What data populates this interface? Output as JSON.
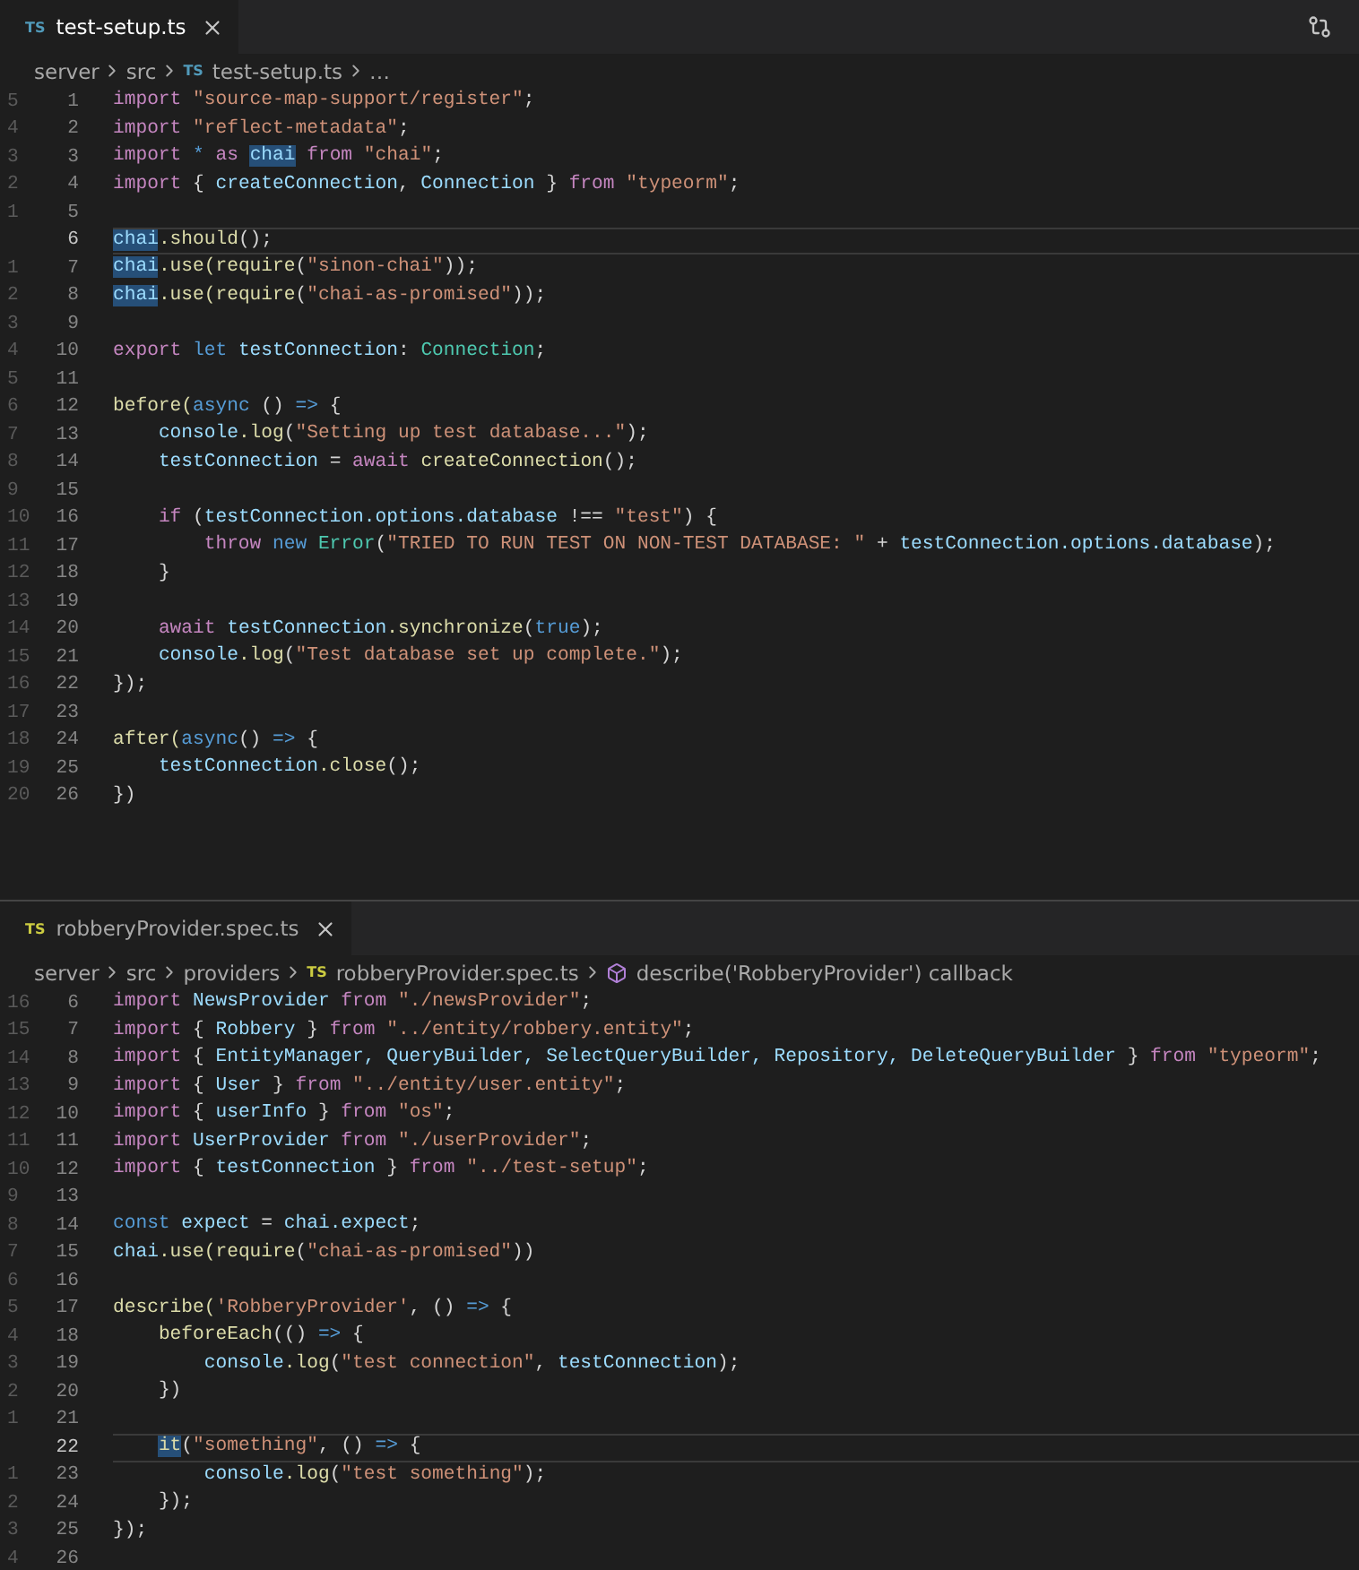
{
  "panes": [
    {
      "tab": {
        "badge": "TS",
        "color": "#519aba",
        "label": "test-setup.ts",
        "focused": true
      },
      "breadcrumb": [
        {
          "kind": "segment",
          "text": "server"
        },
        {
          "kind": "segment",
          "text": "src"
        },
        {
          "kind": "file",
          "badge": "TS",
          "color": "#519aba",
          "text": "test-setup.ts"
        },
        {
          "kind": "segment",
          "text": "…"
        }
      ],
      "lines": [
        {
          "rel": "5",
          "num": "1",
          "current": false,
          "tokens": [
            {
              "text": "import ",
              "kind": "keyword"
            },
            {
              "text": "\"source-map-support/register\"",
              "kind": "string"
            },
            {
              "text": ";",
              "kind": "plain"
            }
          ]
        },
        {
          "rel": "4",
          "num": "2",
          "current": false,
          "tokens": [
            {
              "text": "import ",
              "kind": "keyword"
            },
            {
              "text": "\"reflect-metadata\"",
              "kind": "string"
            },
            {
              "text": ";",
              "kind": "plain"
            }
          ]
        },
        {
          "rel": "3",
          "num": "3",
          "current": false,
          "tokens": [
            {
              "text": "import ",
              "kind": "keyword"
            },
            {
              "text": "* ",
              "kind": "storage"
            },
            {
              "text": "as ",
              "kind": "keyword"
            },
            {
              "text": "chai",
              "kind": "variable",
              "highlighted": true
            },
            {
              "text": " from ",
              "kind": "keyword"
            },
            {
              "text": "\"chai\"",
              "kind": "string"
            },
            {
              "text": ";",
              "kind": "plain"
            }
          ]
        },
        {
          "rel": "2",
          "num": "4",
          "current": false,
          "tokens": [
            {
              "text": "import ",
              "kind": "keyword"
            },
            {
              "text": "{ ",
              "kind": "plain"
            },
            {
              "text": "createConnection",
              "kind": "variable"
            },
            {
              "text": ", ",
              "kind": "plain"
            },
            {
              "text": "Connection",
              "kind": "variable"
            },
            {
              "text": " } ",
              "kind": "plain"
            },
            {
              "text": "from ",
              "kind": "keyword"
            },
            {
              "text": "\"typeorm\"",
              "kind": "string"
            },
            {
              "text": ";",
              "kind": "plain"
            }
          ]
        },
        {
          "rel": "1",
          "num": "5",
          "current": false
        },
        {
          "num": "6",
          "current": true,
          "tokens": [
            {
              "text": "chai",
              "kind": "variable",
              "highlighted": true
            },
            {
              "text": ".should",
              "kind": "function"
            },
            {
              "text": "();",
              "kind": "plain"
            }
          ]
        },
        {
          "rel": "1",
          "num": "7",
          "current": false,
          "tokens": [
            {
              "text": "chai",
              "kind": "variable",
              "highlighted": true
            },
            {
              "text": ".use(require",
              "kind": "function"
            },
            {
              "text": "(",
              "kind": "plain"
            },
            {
              "text": "\"sinon-chai\"",
              "kind": "string"
            },
            {
              "text": "));",
              "kind": "plain"
            }
          ]
        },
        {
          "rel": "2",
          "num": "8",
          "current": false,
          "tokens": [
            {
              "text": "chai",
              "kind": "variable",
              "highlighted": true
            },
            {
              "text": ".use(require",
              "kind": "function"
            },
            {
              "text": "(",
              "kind": "plain"
            },
            {
              "text": "\"chai-as-promised\"",
              "kind": "string"
            },
            {
              "text": "));",
              "kind": "plain"
            }
          ]
        },
        {
          "rel": "3",
          "num": "9",
          "current": false
        },
        {
          "rel": "4",
          "num": "10",
          "current": false,
          "tokens": [
            {
              "text": "export ",
              "kind": "keyword"
            },
            {
              "text": "let ",
              "kind": "storage"
            },
            {
              "text": "testConnection",
              "kind": "variable"
            },
            {
              "text": ": ",
              "kind": "plain"
            },
            {
              "text": "Connection",
              "kind": "type"
            },
            {
              "text": ";",
              "kind": "plain"
            }
          ]
        },
        {
          "rel": "5",
          "num": "11",
          "current": false
        },
        {
          "rel": "6",
          "num": "12",
          "current": false,
          "tokens": [
            {
              "text": "before(",
              "kind": "function"
            },
            {
              "text": "async ",
              "kind": "storage"
            },
            {
              "text": "() ",
              "kind": "plain"
            },
            {
              "text": "=>",
              "kind": "storage"
            },
            {
              "text": " {",
              "kind": "plain"
            }
          ]
        },
        {
          "rel": "7",
          "num": "13",
          "current": false,
          "tokens": [
            {
              "text": "    console",
              "kind": "variable"
            },
            {
              "text": ".log",
              "kind": "function"
            },
            {
              "text": "(",
              "kind": "plain"
            },
            {
              "text": "\"Setting up test database...\"",
              "kind": "string"
            },
            {
              "text": ");",
              "kind": "plain"
            }
          ]
        },
        {
          "rel": "8",
          "num": "14",
          "current": false,
          "tokens": [
            {
              "text": "    testConnection",
              "kind": "variable"
            },
            {
              "text": " = ",
              "kind": "plain"
            },
            {
              "text": "await ",
              "kind": "keyword"
            },
            {
              "text": "createConnection",
              "kind": "function"
            },
            {
              "text": "();",
              "kind": "plain"
            }
          ]
        },
        {
          "rel": "9",
          "num": "15",
          "current": false
        },
        {
          "rel": "10",
          "num": "16",
          "current": false,
          "tokens": [
            {
              "text": "    if ",
              "kind": "keyword"
            },
            {
              "text": "(",
              "kind": "plain"
            },
            {
              "text": "testConnection.options.database",
              "kind": "variable"
            },
            {
              "text": " !== ",
              "kind": "plain"
            },
            {
              "text": "\"test\"",
              "kind": "string"
            },
            {
              "text": ") {",
              "kind": "plain"
            }
          ]
        },
        {
          "rel": "11",
          "num": "17",
          "current": false,
          "tokens": [
            {
              "text": "        throw ",
              "kind": "keyword"
            },
            {
              "text": "new ",
              "kind": "storage"
            },
            {
              "text": "Error",
              "kind": "type"
            },
            {
              "text": "(",
              "kind": "plain"
            },
            {
              "text": "\"TRIED TO RUN TEST ON NON-TEST DATABASE: \"",
              "kind": "string"
            },
            {
              "text": " + ",
              "kind": "plain"
            },
            {
              "text": "testConnection.options.database",
              "kind": "variable"
            },
            {
              "text": ");",
              "kind": "plain"
            }
          ]
        },
        {
          "rel": "12",
          "num": "18",
          "current": false,
          "tokens": [
            {
              "text": "    }",
              "kind": "plain"
            }
          ]
        },
        {
          "rel": "13",
          "num": "19",
          "current": false
        },
        {
          "rel": "14",
          "num": "20",
          "current": false,
          "tokens": [
            {
              "text": "    await ",
              "kind": "keyword"
            },
            {
              "text": "testConnection",
              "kind": "variable"
            },
            {
              "text": ".synchronize",
              "kind": "function"
            },
            {
              "text": "(",
              "kind": "plain"
            },
            {
              "text": "true",
              "kind": "storage"
            },
            {
              "text": ");",
              "kind": "plain"
            }
          ]
        },
        {
          "rel": "15",
          "num": "21",
          "current": false,
          "tokens": [
            {
              "text": "    console",
              "kind": "variable"
            },
            {
              "text": ".log",
              "kind": "function"
            },
            {
              "text": "(",
              "kind": "plain"
            },
            {
              "text": "\"Test database set up complete.\"",
              "kind": "string"
            },
            {
              "text": ");",
              "kind": "plain"
            }
          ]
        },
        {
          "rel": "16",
          "num": "22",
          "current": false,
          "tokens": [
            {
              "text": "});",
              "kind": "plain"
            }
          ]
        },
        {
          "rel": "17",
          "num": "23",
          "current": false
        },
        {
          "rel": "18",
          "num": "24",
          "current": false,
          "tokens": [
            {
              "text": "after(",
              "kind": "function"
            },
            {
              "text": "async",
              "kind": "storage"
            },
            {
              "text": "() ",
              "kind": "plain"
            },
            {
              "text": "=>",
              "kind": "storage"
            },
            {
              "text": " {",
              "kind": "plain"
            }
          ]
        },
        {
          "rel": "19",
          "num": "25",
          "current": false,
          "tokens": [
            {
              "text": "    testConnection",
              "kind": "variable"
            },
            {
              "text": ".close",
              "kind": "function"
            },
            {
              "text": "();",
              "kind": "plain"
            }
          ]
        },
        {
          "rel": "20",
          "num": "26",
          "current": false,
          "tokens": [
            {
              "text": "})",
              "kind": "plain"
            }
          ]
        }
      ]
    },
    {
      "tab": {
        "badge": "TS",
        "color": "#cbcb41",
        "label": "robberyProvider.spec.ts",
        "focused": false
      },
      "breadcrumb": [
        {
          "kind": "segment",
          "text": "server"
        },
        {
          "kind": "segment",
          "text": "src"
        },
        {
          "kind": "segment",
          "text": "providers"
        },
        {
          "kind": "file",
          "badge": "TS",
          "color": "#cbcb41",
          "text": "robberyProvider.spec.ts"
        },
        {
          "kind": "symbol",
          "text": "describe('RobberyProvider') callback"
        }
      ],
      "lines": [
        {
          "rel": "16",
          "num": "6",
          "current": false,
          "tokens": [
            {
              "text": "import ",
              "kind": "keyword"
            },
            {
              "text": "NewsProvider",
              "kind": "variable"
            },
            {
              "text": " from ",
              "kind": "keyword"
            },
            {
              "text": "\"./newsProvider\"",
              "kind": "string"
            },
            {
              "text": ";",
              "kind": "plain"
            }
          ]
        },
        {
          "rel": "15",
          "num": "7",
          "current": false,
          "tokens": [
            {
              "text": "import ",
              "kind": "keyword"
            },
            {
              "text": "{ ",
              "kind": "plain"
            },
            {
              "text": "Robbery",
              "kind": "variable"
            },
            {
              "text": " } ",
              "kind": "plain"
            },
            {
              "text": "from ",
              "kind": "keyword"
            },
            {
              "text": "\"../entity/robbery.entity\"",
              "kind": "string"
            },
            {
              "text": ";",
              "kind": "plain"
            }
          ]
        },
        {
          "rel": "14",
          "num": "8",
          "current": false,
          "tokens": [
            {
              "text": "import ",
              "kind": "keyword"
            },
            {
              "text": "{ ",
              "kind": "plain"
            },
            {
              "text": "EntityManager, QueryBuilder, SelectQueryBuilder, Repository, DeleteQueryBuilder",
              "kind": "variable"
            },
            {
              "text": " } ",
              "kind": "plain"
            },
            {
              "text": "from ",
              "kind": "keyword"
            },
            {
              "text": "\"typeorm\"",
              "kind": "string"
            },
            {
              "text": ";",
              "kind": "plain"
            }
          ]
        },
        {
          "rel": "13",
          "num": "9",
          "current": false,
          "tokens": [
            {
              "text": "import ",
              "kind": "keyword"
            },
            {
              "text": "{ ",
              "kind": "plain"
            },
            {
              "text": "User",
              "kind": "variable"
            },
            {
              "text": " } ",
              "kind": "plain"
            },
            {
              "text": "from ",
              "kind": "keyword"
            },
            {
              "text": "\"../entity/user.entity\"",
              "kind": "string"
            },
            {
              "text": ";",
              "kind": "plain"
            }
          ]
        },
        {
          "rel": "12",
          "num": "10",
          "current": false,
          "tokens": [
            {
              "text": "import ",
              "kind": "keyword"
            },
            {
              "text": "{ ",
              "kind": "plain"
            },
            {
              "text": "userInfo",
              "kind": "variable"
            },
            {
              "text": " } ",
              "kind": "plain"
            },
            {
              "text": "from ",
              "kind": "keyword"
            },
            {
              "text": "\"os\"",
              "kind": "string"
            },
            {
              "text": ";",
              "kind": "plain"
            }
          ]
        },
        {
          "rel": "11",
          "num": "11",
          "current": false,
          "tokens": [
            {
              "text": "import ",
              "kind": "keyword"
            },
            {
              "text": "UserProvider",
              "kind": "variable"
            },
            {
              "text": " from ",
              "kind": "keyword"
            },
            {
              "text": "\"./userProvider\"",
              "kind": "string"
            },
            {
              "text": ";",
              "kind": "plain"
            }
          ]
        },
        {
          "rel": "10",
          "num": "12",
          "current": false,
          "tokens": [
            {
              "text": "import ",
              "kind": "keyword"
            },
            {
              "text": "{ ",
              "kind": "plain"
            },
            {
              "text": "testConnection",
              "kind": "variable"
            },
            {
              "text": " } ",
              "kind": "plain"
            },
            {
              "text": "from ",
              "kind": "keyword"
            },
            {
              "text": "\"../test-setup\"",
              "kind": "string"
            },
            {
              "text": ";",
              "kind": "plain"
            }
          ]
        },
        {
          "rel": "9",
          "num": "13",
          "current": false
        },
        {
          "rel": "8",
          "num": "14",
          "current": false,
          "tokens": [
            {
              "text": "const ",
              "kind": "storage"
            },
            {
              "text": "expect",
              "kind": "variable"
            },
            {
              "text": " = ",
              "kind": "plain"
            },
            {
              "text": "chai.expect",
              "kind": "variable"
            },
            {
              "text": ";",
              "kind": "plain"
            }
          ]
        },
        {
          "rel": "7",
          "num": "15",
          "current": false,
          "tokens": [
            {
              "text": "chai",
              "kind": "variable"
            },
            {
              "text": ".use(require",
              "kind": "function"
            },
            {
              "text": "(",
              "kind": "plain"
            },
            {
              "text": "\"chai-as-promised\"",
              "kind": "string"
            },
            {
              "text": "))",
              "kind": "plain"
            }
          ]
        },
        {
          "rel": "6",
          "num": "16",
          "current": false
        },
        {
          "rel": "5",
          "num": "17",
          "current": false,
          "tokens": [
            {
              "text": "describe(",
              "kind": "function"
            },
            {
              "text": "'RobberyProvider'",
              "kind": "string"
            },
            {
              "text": ", () ",
              "kind": "plain"
            },
            {
              "text": "=>",
              "kind": "storage"
            },
            {
              "text": " {",
              "kind": "plain"
            }
          ]
        },
        {
          "rel": "4",
          "num": "18",
          "current": false,
          "tokens": [
            {
              "text": "    beforeEach",
              "kind": "function"
            },
            {
              "text": "(() ",
              "kind": "plain"
            },
            {
              "text": "=>",
              "kind": "storage"
            },
            {
              "text": " {",
              "kind": "plain"
            }
          ]
        },
        {
          "rel": "3",
          "num": "19",
          "current": false,
          "tokens": [
            {
              "text": "        console",
              "kind": "variable"
            },
            {
              "text": ".log",
              "kind": "function"
            },
            {
              "text": "(",
              "kind": "plain"
            },
            {
              "text": "\"test connection\"",
              "kind": "string"
            },
            {
              "text": ", ",
              "kind": "plain"
            },
            {
              "text": "testConnection",
              "kind": "variable"
            },
            {
              "text": ");",
              "kind": "plain"
            }
          ]
        },
        {
          "rel": "2",
          "num": "20",
          "current": false,
          "tokens": [
            {
              "text": "    })",
              "kind": "plain"
            }
          ]
        },
        {
          "rel": "1",
          "num": "21",
          "current": false
        },
        {
          "num": "22",
          "current": true,
          "tokens": [
            {
              "text": "    it",
              "kind": "function",
              "highlighted": true
            },
            {
              "text": "(",
              "kind": "plain"
            },
            {
              "text": "\"something\"",
              "kind": "string"
            },
            {
              "text": ", () ",
              "kind": "plain"
            },
            {
              "text": "=>",
              "kind": "storage"
            },
            {
              "text": " {",
              "kind": "plain"
            }
          ]
        },
        {
          "rel": "1",
          "num": "23",
          "current": false,
          "tokens": [
            {
              "text": "        console",
              "kind": "variable"
            },
            {
              "text": ".log",
              "kind": "function"
            },
            {
              "text": "(",
              "kind": "plain"
            },
            {
              "text": "\"test something\"",
              "kind": "string"
            },
            {
              "text": ");",
              "kind": "plain"
            }
          ]
        },
        {
          "rel": "2",
          "num": "24",
          "current": false,
          "tokens": [
            {
              "text": "    });",
              "kind": "plain"
            }
          ]
        },
        {
          "rel": "3",
          "num": "25",
          "current": false,
          "tokens": [
            {
              "text": "});",
              "kind": "plain"
            }
          ]
        },
        {
          "rel": "4",
          "num": "26",
          "current": false
        }
      ]
    }
  ]
}
